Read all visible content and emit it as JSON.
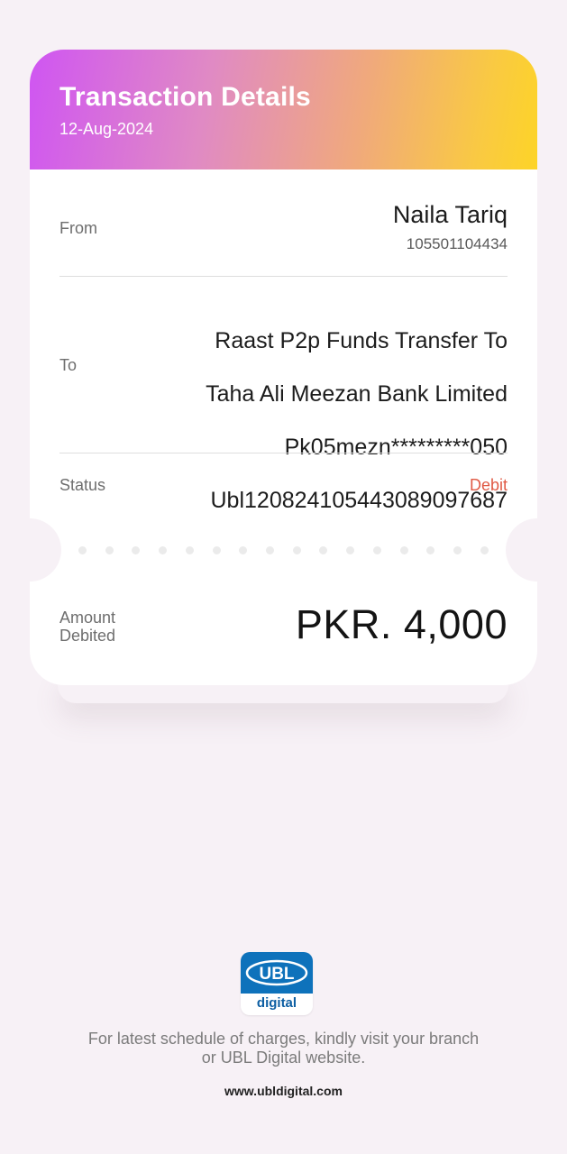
{
  "header": {
    "title": "Transaction Details",
    "date": "12-Aug-2024",
    "gradient": [
      "#cf55f2",
      "#f0a97c",
      "#fdd427"
    ]
  },
  "from": {
    "label": "From",
    "name": "Naila Tariq",
    "account": "105501104434"
  },
  "to": {
    "label": "To",
    "lines": [
      "Raast P2p Funds Transfer To",
      "Taha Ali Meezan Bank Limited",
      "Pk05mezn*********050",
      "Ubl120824105443089097687"
    ]
  },
  "status": {
    "label": "Status",
    "value": "Debit",
    "color": "#e05a45"
  },
  "amount": {
    "label": "Amount\nDebited",
    "value": "PKR. 4,000"
  },
  "footer": {
    "logo_text": "UBL",
    "logo_subtext": "digital",
    "logo_color": "#0e72bb",
    "note": "For latest schedule of charges, kindly visit your branch\nor UBL Digital website.",
    "url": "www.ubldigital.com"
  }
}
